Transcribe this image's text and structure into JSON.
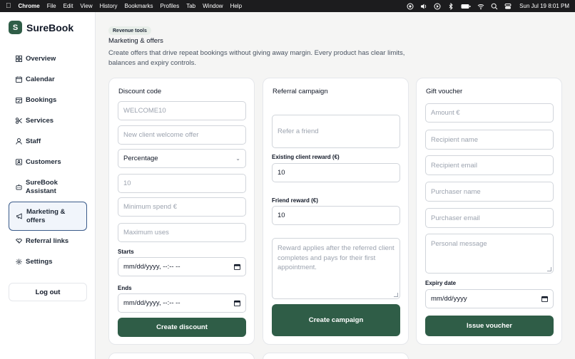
{
  "menubar": {
    "app": "Chrome",
    "items": [
      "File",
      "Edit",
      "View",
      "History",
      "Bookmarks",
      "Profiles",
      "Tab",
      "Window",
      "Help"
    ],
    "clock": "Sun Jul 19  8:01 PM"
  },
  "brand": {
    "logo_letter": "S",
    "name": "SureBook"
  },
  "sidebar": {
    "items": [
      {
        "label": "Overview",
        "icon": "grid-icon"
      },
      {
        "label": "Calendar",
        "icon": "calendar-icon"
      },
      {
        "label": "Bookings",
        "icon": "calendar-check-icon"
      },
      {
        "label": "Services",
        "icon": "scissors-icon"
      },
      {
        "label": "Staff",
        "icon": "user-icon"
      },
      {
        "label": "Customers",
        "icon": "id-card-icon"
      },
      {
        "label": "SureBook Assistant",
        "icon": "robot-icon"
      },
      {
        "label": "Marketing & offers",
        "icon": "megaphone-icon",
        "active": true
      },
      {
        "label": "Referral links",
        "icon": "handshake-icon"
      },
      {
        "label": "Settings",
        "icon": "gear-icon"
      }
    ],
    "logout": "Log out"
  },
  "header": {
    "pill": "Revenue tools",
    "title": "Marketing & offers",
    "description": "Create offers that drive repeat bookings without giving away margin. Every product has clear limits, balances and expiry controls."
  },
  "discount": {
    "title": "Discount code",
    "code_placeholder": "WELCOME10",
    "name_placeholder": "New client welcome offer",
    "type_value": "Percentage",
    "amount_placeholder": "10",
    "min_spend_placeholder": "Minimum spend €",
    "max_uses_placeholder": "Maximum uses",
    "starts_label": "Starts",
    "starts_placeholder": "mm/dd/yyyy, --:-- --",
    "ends_label": "Ends",
    "ends_placeholder": "mm/dd/yyyy, --:-- --",
    "button": "Create discount"
  },
  "referral": {
    "title": "Referral campaign",
    "name_placeholder": "Refer a friend",
    "existing_label": "Existing client reward (€)",
    "existing_value": "10",
    "friend_label": "Friend reward (€)",
    "friend_value": "10",
    "terms_placeholder": "Reward applies after the referred client completes and pays for their first appointment.",
    "button": "Create campaign"
  },
  "voucher": {
    "title": "Gift voucher",
    "amount_placeholder": "Amount €",
    "recipient_name_placeholder": "Recipient name",
    "recipient_email_placeholder": "Recipient email",
    "purchaser_name_placeholder": "Purchaser name",
    "purchaser_email_placeholder": "Purchaser email",
    "message_placeholder": "Personal message",
    "expiry_label": "Expiry date",
    "expiry_placeholder": "mm/dd/yyyy",
    "button": "Issue voucher"
  }
}
